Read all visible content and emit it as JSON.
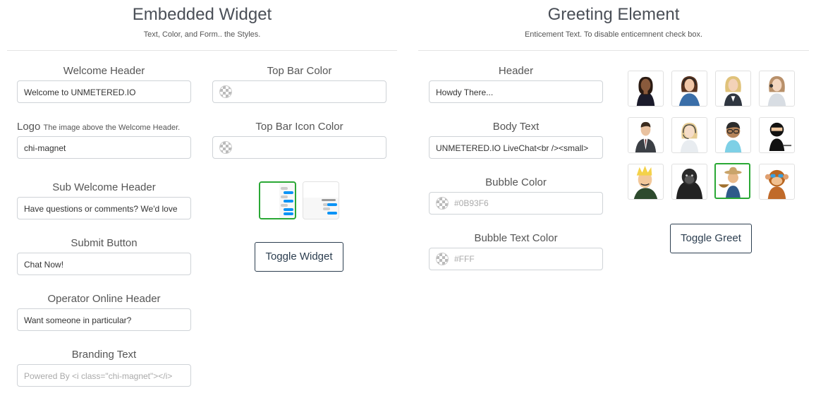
{
  "embedded": {
    "title": "Embedded Widget",
    "subtitle": "Text, Color, and Form.. the Styles.",
    "welcome_header": {
      "label": "Welcome Header",
      "value": "Welcome to UNMETERED.IO"
    },
    "logo": {
      "label": "Logo",
      "hint": "The image above the Welcome Header.",
      "value": "chi-magnet"
    },
    "sub_welcome_header": {
      "label": "Sub Welcome Header",
      "value": "Have questions or comments? We'd love"
    },
    "submit_button": {
      "label": "Submit Button",
      "value": "Chat Now!"
    },
    "operator_online_header": {
      "label": "Operator Online Header",
      "value": "Want someone in particular?"
    },
    "branding_text": {
      "label": "Branding Text",
      "placeholder": "Powered By <i class=\"chi-magnet\"></i>"
    },
    "top_bar_color": {
      "label": "Top Bar Color",
      "value": ""
    },
    "top_bar_icon_color": {
      "label": "Top Bar Icon Color",
      "value": ""
    },
    "layouts": [
      {
        "name": "layout-side",
        "selected": true
      },
      {
        "name": "layout-bottom",
        "selected": false
      }
    ],
    "toggle_label": "Toggle Widget"
  },
  "greeting": {
    "title": "Greeting Element",
    "subtitle": "Enticement Text. To disable enticemnent check box.",
    "header": {
      "label": "Header",
      "value": "Howdy There..."
    },
    "body_text": {
      "label": "Body Text",
      "value": "UNMETERED.IO LiveChat<br /><small>"
    },
    "bubble_color": {
      "label": "Bubble Color",
      "placeholder": "#0B93F6"
    },
    "bubble_text_color": {
      "label": "Bubble Text Color",
      "placeholder": "#FFF"
    },
    "avatars": [
      {
        "icon": "woman-headset-icon",
        "selected": false
      },
      {
        "icon": "woman-headset-blue-icon",
        "selected": false
      },
      {
        "icon": "blonde-woman-icon",
        "selected": false
      },
      {
        "icon": "woman-phone-icon",
        "selected": false
      },
      {
        "icon": "businessman-icon",
        "selected": false
      },
      {
        "icon": "woman-blonde-headset-icon",
        "selected": false
      },
      {
        "icon": "cartoon-boy-icon",
        "selected": false
      },
      {
        "icon": "ninja-icon",
        "selected": false
      },
      {
        "icon": "cartoon-blonde-man-icon",
        "selected": false
      },
      {
        "icon": "gorilla-icon",
        "selected": false
      },
      {
        "icon": "farmer-icon",
        "selected": true
      },
      {
        "icon": "monkey-sunglasses-icon",
        "selected": false
      }
    ],
    "toggle_label": "Toggle Greet"
  },
  "colors": {
    "accent_selected": "#2aa835",
    "bubble_blue": "#0B93F6",
    "button_border": "#2c3e50"
  }
}
